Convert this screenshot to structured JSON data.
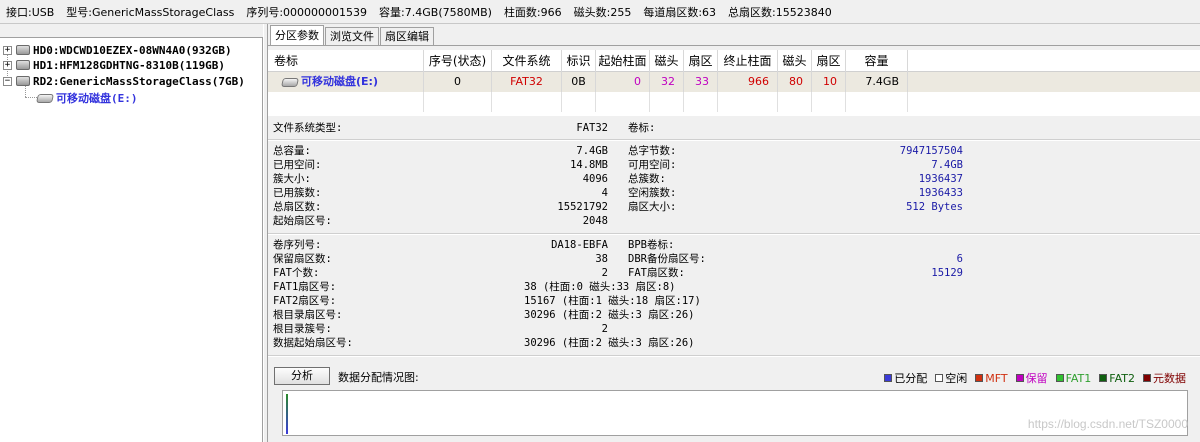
{
  "infobar": {
    "interface": "接口:USB",
    "model": "型号:GenericMassStorageClass",
    "serial": "序列号:000000001539",
    "capacity": "容量:7.4GB(7580MB)",
    "cylinders": "柱面数:966",
    "heads": "磁头数:255",
    "sectors_per_track": "每道扇区数:63",
    "total_sectors": "总扇区数:15523840"
  },
  "tree": {
    "disks": [
      {
        "label": "HD0:WDCWD10EZEX-08WN4A0(932GB)",
        "expander": "+"
      },
      {
        "label": "HD1:HFM128GDHTNG-8310B(119GB)",
        "expander": "+"
      },
      {
        "label": "RD2:GenericMassStorageClass(7GB)",
        "expander": "−"
      }
    ],
    "partition": "可移动磁盘(E:)"
  },
  "tabs": [
    "分区参数",
    "浏览文件",
    "扇区编辑"
  ],
  "table": {
    "headers": [
      "卷标",
      "序号(状态)",
      "文件系统",
      "标识",
      "起始柱面",
      "磁头",
      "扇区",
      "终止柱面",
      "磁头",
      "扇区",
      "容量"
    ],
    "row": {
      "label": "可移动磁盘(E:)",
      "seq": "0",
      "fs": "FAT32",
      "id": "0B",
      "start_cyl": "0",
      "start_head": "32",
      "start_sec": "33",
      "end_cyl": "966",
      "end_head": "80",
      "end_sec": "10",
      "capacity": "7.4GB"
    }
  },
  "details": {
    "fs_type_label": "文件系统类型:",
    "fs_type_value": "FAT32",
    "volume_label": "卷标:",
    "total_cap_label": "总容量:",
    "total_cap_value": "7.4GB",
    "used_label": "已用空间:",
    "used_value": "14.8MB",
    "cluster_size_label": "簇大小:",
    "cluster_size_value": "4096",
    "used_clusters_label": "已用簇数:",
    "used_clusters_value": "4",
    "total_sectors_label": "总扇区数:",
    "total_sectors_value": "15521792",
    "start_sector_label": "起始扇区号:",
    "start_sector_value": "2048",
    "total_bytes_label": "总字节数:",
    "total_bytes_value": "7947157504",
    "free_label": "可用空间:",
    "free_value": "7.4GB",
    "total_clusters_label": "总簇数:",
    "total_clusters_value": "1936437",
    "free_clusters_label": "空闲簇数:",
    "free_clusters_value": "1936433",
    "sector_size_label": "扇区大小:",
    "sector_size_value": "512 Bytes",
    "vol_serial_label": "卷序列号:",
    "vol_serial_value": "DA18-EBFA",
    "reserved_label": "保留扇区数:",
    "reserved_value": "38",
    "fat_count_label": "FAT个数:",
    "fat_count_value": "2",
    "fat1_label": "FAT1扇区号:",
    "fat1_value": "38 (柱面:0 磁头:33 扇区:8)",
    "fat2_label": "FAT2扇区号:",
    "fat2_value": "15167 (柱面:1 磁头:18 扇区:17)",
    "root_sector_label": "根目录扇区号:",
    "root_sector_value": "30296 (柱面:2 磁头:3 扇区:26)",
    "root_cluster_label": "根目录簇号:",
    "root_cluster_value": "2",
    "data_start_label": "数据起始扇区号:",
    "data_start_value": "30296 (柱面:2 磁头:3 扇区:26)",
    "bpb_label": "BPB卷标:",
    "dbr_backup_label": "DBR备份扇区号:",
    "dbr_backup_value": "6",
    "fat_sectors_label": "FAT扇区数:",
    "fat_sectors_value": "15129"
  },
  "analyze": {
    "button": "分析",
    "map_title": "数据分配情况图:",
    "legend": [
      {
        "label": "已分配",
        "color": "#3b3bd8"
      },
      {
        "label": "空闲",
        "color": "#ffffff"
      },
      {
        "label": "MFT",
        "color": "#d03010"
      },
      {
        "label": "保留",
        "color": "#c000c0"
      },
      {
        "label": "FAT1",
        "color": "#30c030"
      },
      {
        "label": "FAT2",
        "color": "#106010"
      },
      {
        "label": "元数据",
        "color": "#800000"
      }
    ]
  },
  "watermark": "https://blog.csdn.net/TSZ0000"
}
